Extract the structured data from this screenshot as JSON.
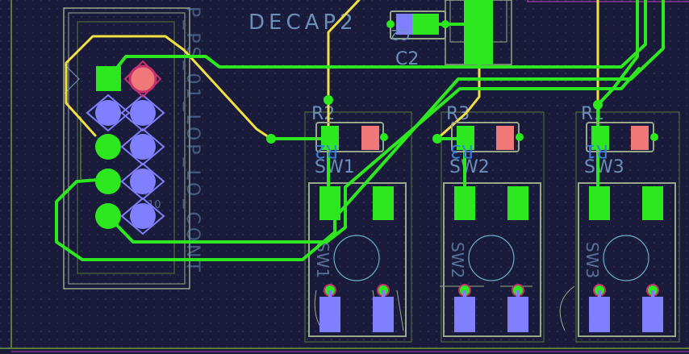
{
  "colors": {
    "background": "#1a1b3a",
    "grid_dot": "#3a3d6a",
    "board_outline": "#5a7a3a",
    "keepout": "#c040c0",
    "top_copper": "#2de81e",
    "bottom_copper": "#8080ff",
    "silkscreen_top": "#6a8fb8",
    "silkscreen_outline": "#9aa88a",
    "yellow_trace": "#f0e040",
    "resistor_pad": "#f07878",
    "via_ring": "#c43070"
  },
  "labels": {
    "decap": "DECAP2",
    "c2": "C2",
    "r2_top": "R2",
    "r2_bottom": "R2",
    "r3_top": "R3",
    "r3_bottom": "R3",
    "r1_top": "R1",
    "r1_bottom": "R1",
    "c2_bottom": "C2",
    "sw1_top": "SW1",
    "sw2_top": "SW2",
    "sw3_top": "SW3",
    "sw1_bottom": "SW1",
    "sw2_bottom": "SW2",
    "sw3_bottom": "SW3",
    "header_silk": "P_PS_01_LOP_LO_CONT",
    "pin_label": "10"
  }
}
